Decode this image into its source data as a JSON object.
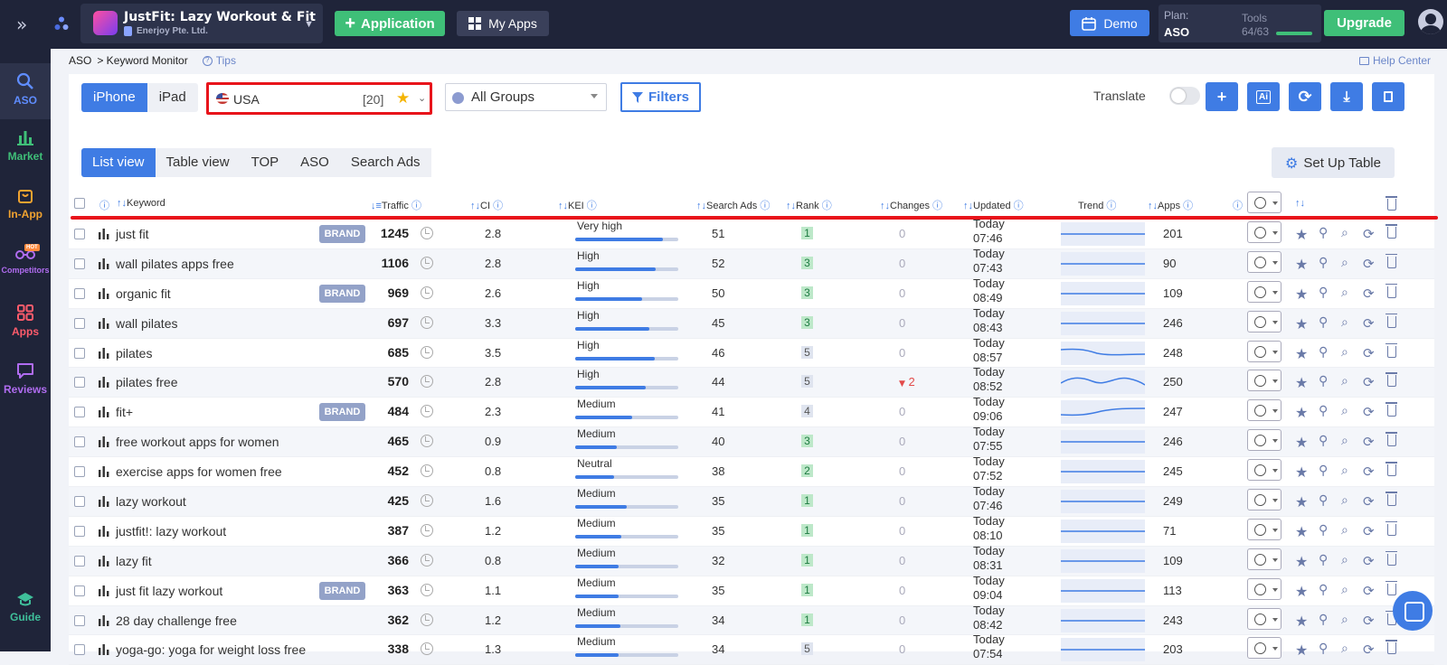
{
  "topbar": {
    "app_name": "JustFit: Lazy Workout & Fit",
    "developer": "Enerjoy Pte. Ltd.",
    "application_button": "Application",
    "my_apps_button": "My Apps",
    "demo_button": "Demo",
    "plan_label": "Plan:",
    "plan_value": "ASO",
    "tools_label": "Tools",
    "tools_value": "64/63",
    "upgrade_button": "Upgrade"
  },
  "sidebar": {
    "items": [
      {
        "label": "ASO",
        "icon": "search-icon",
        "color": "#5f8dff"
      },
      {
        "label": "Market",
        "icon": "bar-chart-icon",
        "color": "#3fbf78"
      },
      {
        "label": "In-App",
        "icon": "bag-icon",
        "color": "#f0a330"
      },
      {
        "label": "Competitors",
        "icon": "glasses-icon",
        "color": "#b06cf0",
        "badge": "HOT"
      },
      {
        "label": "Apps",
        "icon": "grid-icon",
        "color": "#ff5b6b"
      },
      {
        "label": "Reviews",
        "icon": "chat-icon",
        "color": "#b06cf0"
      },
      {
        "label": "Guide",
        "icon": "graduation-cap-icon",
        "color": "#3fbf9a"
      }
    ]
  },
  "breadcrumb": {
    "root": "ASO",
    "current": "> Keyword Monitor",
    "tips": "Tips",
    "help_center": "Help Center"
  },
  "controls": {
    "device_tabs": [
      "iPhone",
      "iPad"
    ],
    "country": "USA",
    "country_count": "[20]",
    "groups": "All Groups",
    "filters": "Filters",
    "translate": "Translate",
    "view_tabs": [
      "List view",
      "Table view",
      "TOP",
      "ASO",
      "Search Ads"
    ],
    "setup_table": "Set Up Table",
    "toolbar_icons": [
      "plus-icon",
      "ai-icon",
      "refresh-icon",
      "download-icon",
      "copy-icon"
    ]
  },
  "columns": {
    "keyword": "Keyword",
    "traffic": "Traffic",
    "ci": "CI",
    "kei": "KEI",
    "search_ads": "Search Ads",
    "rank": "Rank",
    "changes": "Changes",
    "updated": "Updated",
    "trend": "Trend",
    "apps": "Apps"
  },
  "rows": [
    {
      "keyword": "just fit",
      "brand": "BRAND",
      "traffic": "1245",
      "ci": "2.8",
      "kei": "Very high",
      "kei_level": 0.85,
      "search_ads": "51",
      "rank": "1",
      "changes": "0",
      "changes_dir": "",
      "day": "Today",
      "time": "07:46",
      "apps": "201",
      "trend": "flat"
    },
    {
      "keyword": "wall pilates apps free",
      "brand": "",
      "traffic": "1106",
      "ci": "2.8",
      "kei": "High",
      "kei_level": 0.78,
      "search_ads": "52",
      "rank": "3",
      "changes": "0",
      "changes_dir": "",
      "day": "Today",
      "time": "07:43",
      "apps": "90",
      "trend": "flat"
    },
    {
      "keyword": "organic fit",
      "brand": "BRAND",
      "traffic": "969",
      "ci": "2.6",
      "kei": "High",
      "kei_level": 0.65,
      "search_ads": "50",
      "rank": "3",
      "changes": "0",
      "changes_dir": "",
      "day": "Today",
      "time": "08:49",
      "apps": "109",
      "trend": "flat"
    },
    {
      "keyword": "wall pilates",
      "brand": "",
      "traffic": "697",
      "ci": "3.3",
      "kei": "High",
      "kei_level": 0.72,
      "search_ads": "45",
      "rank": "3",
      "changes": "0",
      "changes_dir": "",
      "day": "Today",
      "time": "08:43",
      "apps": "246",
      "trend": "flat"
    },
    {
      "keyword": "pilates",
      "brand": "",
      "traffic": "685",
      "ci": "3.5",
      "kei": "High",
      "kei_level": 0.77,
      "search_ads": "46",
      "rank": "5",
      "changes": "0",
      "changes_dir": "",
      "day": "Today",
      "time": "08:57",
      "apps": "248",
      "trend": "wave"
    },
    {
      "keyword": "pilates free",
      "brand": "",
      "traffic": "570",
      "ci": "2.8",
      "kei": "High",
      "kei_level": 0.68,
      "search_ads": "44",
      "rank": "5",
      "changes": "2",
      "changes_dir": "down",
      "day": "Today",
      "time": "08:52",
      "apps": "250",
      "trend": "wave2"
    },
    {
      "keyword": "fit+",
      "brand": "BRAND",
      "traffic": "484",
      "ci": "2.3",
      "kei": "Medium",
      "kei_level": 0.55,
      "search_ads": "41",
      "rank": "4",
      "changes": "0",
      "changes_dir": "",
      "day": "Today",
      "time": "09:06",
      "apps": "247",
      "trend": "bump"
    },
    {
      "keyword": "free workout apps for women",
      "brand": "",
      "traffic": "465",
      "ci": "0.9",
      "kei": "Medium",
      "kei_level": 0.4,
      "search_ads": "40",
      "rank": "3",
      "changes": "0",
      "changes_dir": "",
      "day": "Today",
      "time": "07:55",
      "apps": "246",
      "trend": "flat"
    },
    {
      "keyword": "exercise apps for women free",
      "brand": "",
      "traffic": "452",
      "ci": "0.8",
      "kei": "Neutral",
      "kei_level": 0.38,
      "search_ads": "38",
      "rank": "2",
      "changes": "0",
      "changes_dir": "",
      "day": "Today",
      "time": "07:52",
      "apps": "245",
      "trend": "flat"
    },
    {
      "keyword": "lazy workout",
      "brand": "",
      "traffic": "425",
      "ci": "1.6",
      "kei": "Medium",
      "kei_level": 0.5,
      "search_ads": "35",
      "rank": "1",
      "changes": "0",
      "changes_dir": "",
      "day": "Today",
      "time": "07:46",
      "apps": "249",
      "trend": "flat"
    },
    {
      "keyword": "justfit!: lazy workout",
      "brand": "",
      "traffic": "387",
      "ci": "1.2",
      "kei": "Medium",
      "kei_level": 0.45,
      "search_ads": "35",
      "rank": "1",
      "changes": "0",
      "changes_dir": "",
      "day": "Today",
      "time": "08:10",
      "apps": "71",
      "trend": "flat"
    },
    {
      "keyword": "lazy fit",
      "brand": "",
      "traffic": "366",
      "ci": "0.8",
      "kei": "Medium",
      "kei_level": 0.42,
      "search_ads": "32",
      "rank": "1",
      "changes": "0",
      "changes_dir": "",
      "day": "Today",
      "time": "08:31",
      "apps": "109",
      "trend": "flat"
    },
    {
      "keyword": "just fit lazy workout",
      "brand": "BRAND",
      "traffic": "363",
      "ci": "1.1",
      "kei": "Medium",
      "kei_level": 0.42,
      "search_ads": "35",
      "rank": "1",
      "changes": "0",
      "changes_dir": "",
      "day": "Today",
      "time": "09:04",
      "apps": "113",
      "trend": "flat"
    },
    {
      "keyword": "28 day challenge free",
      "brand": "",
      "traffic": "362",
      "ci": "1.2",
      "kei": "Medium",
      "kei_level": 0.44,
      "search_ads": "34",
      "rank": "1",
      "changes": "0",
      "changes_dir": "",
      "day": "Today",
      "time": "08:42",
      "apps": "243",
      "trend": "flat"
    },
    {
      "keyword": "yoga-go: yoga for weight loss free",
      "brand": "",
      "traffic": "338",
      "ci": "1.3",
      "kei": "Medium",
      "kei_level": 0.42,
      "search_ads": "34",
      "rank": "5",
      "changes": "0",
      "changes_dir": "",
      "day": "Today",
      "time": "07:54",
      "apps": "203",
      "trend": "flat"
    }
  ]
}
